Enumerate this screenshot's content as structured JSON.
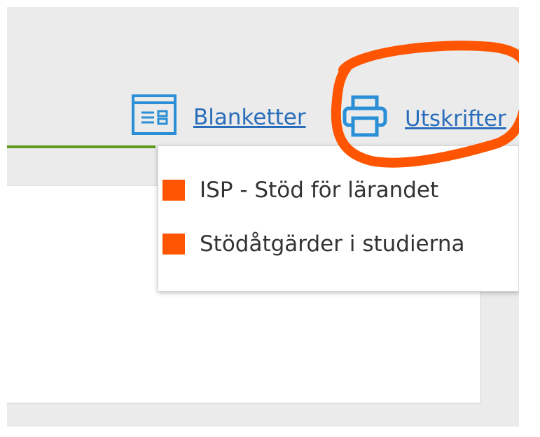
{
  "toolbar": {
    "blanketter_label": "Blanketter",
    "utskrifter_label": "Utskrifter",
    "blanketter_icon": "form-icon",
    "utskrifter_icon": "printer-icon"
  },
  "dropdown": {
    "items": [
      {
        "label": "ISP - Stöd för lärandet",
        "marker_color": "#ff5500"
      },
      {
        "label": "Stödåtgärder i studierna",
        "marker_color": "#ff5500"
      }
    ]
  },
  "colors": {
    "link": "#2a6ebb",
    "annotation": "#ff5500",
    "accent_line": "#5f9a1a"
  }
}
